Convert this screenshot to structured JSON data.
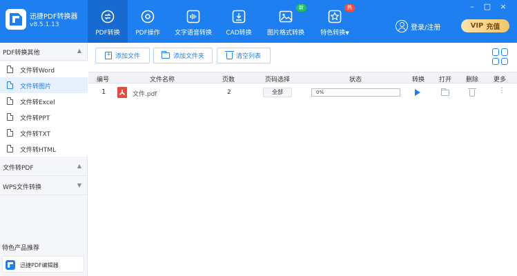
{
  "app": {
    "name": "迅捷PDF转换器",
    "version": "v8.5.1.13"
  },
  "colors": {
    "primary": "#1d7ff0",
    "active_tab": "#176ad0",
    "badge_new": "#21c25e",
    "badge_hot": "#ff4b3a",
    "pdf_red": "#e64a3b",
    "vip_gold": "#f3c66b"
  },
  "window_controls": {
    "minimize": "–",
    "restore": "□",
    "close": "×"
  },
  "nav": {
    "tabs": [
      {
        "label": "PDF转换",
        "icon": "swap-icon",
        "active": true
      },
      {
        "label": "PDF操作",
        "icon": "gear-icon"
      },
      {
        "label": "文字语音转换",
        "icon": "audio-wave-icon"
      },
      {
        "label": "CAD转换",
        "icon": "download-box-icon"
      },
      {
        "label": "图片格式转换",
        "icon": "image-icon",
        "badge": "新"
      },
      {
        "label": "特色转换",
        "icon": "star-icon",
        "badge": "热",
        "caret": "▼"
      }
    ]
  },
  "user": {
    "login_label": "登录/注册",
    "vip_label": "VIP",
    "recharge_label": "充值"
  },
  "sidebar": {
    "groups": [
      {
        "title": "PDF转换其他",
        "caret": "▲",
        "items": [
          {
            "label": "文件转Word"
          },
          {
            "label": "文件转图片",
            "active": true
          },
          {
            "label": "文件转Excel"
          },
          {
            "label": "文件转PPT"
          },
          {
            "label": "文件转TXT"
          },
          {
            "label": "文件转HTML"
          }
        ]
      },
      {
        "title": "文件转PDF",
        "caret": "▲"
      },
      {
        "title": "WPS文件转换",
        "caret": "▼"
      }
    ],
    "featured_title": "特色产品推荐",
    "featured_item": "迅捷PDF编辑器"
  },
  "toolbar": {
    "add_file": "添加文件",
    "add_folder": "添加文件夹",
    "clear_list": "清空列表",
    "layout_toggle_icon": "grid-layout-icon"
  },
  "table": {
    "columns": [
      "编号",
      "文件名称",
      "页数",
      "页码选择",
      "状态",
      "转换",
      "打开",
      "删除",
      "更多"
    ],
    "rows": [
      {
        "index": "1",
        "file_name": "文件.pdf",
        "pages": "2",
        "page_range": "全部",
        "progress_percent": 0,
        "progress_text": "0%",
        "more": "⋮"
      }
    ]
  }
}
